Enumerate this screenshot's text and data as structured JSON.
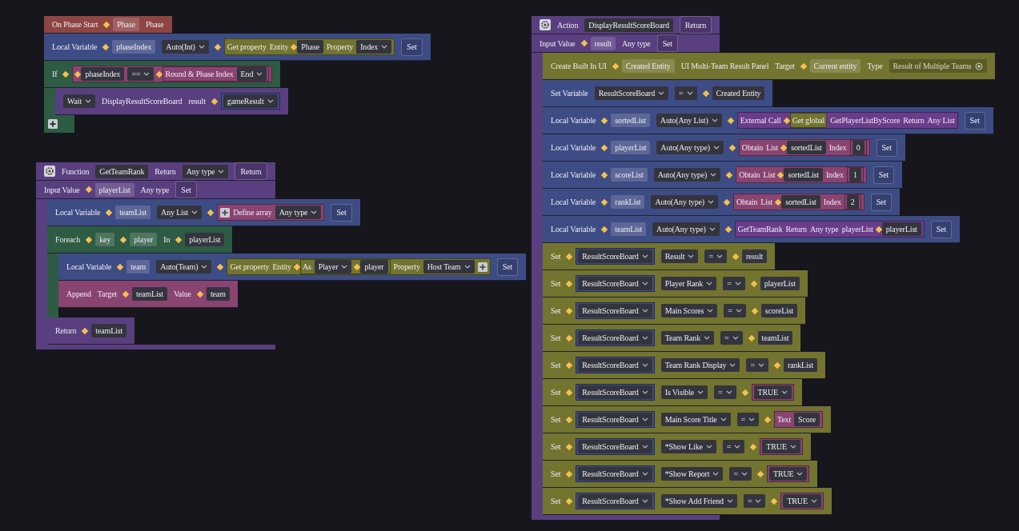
{
  "stacks": [
    {
      "blocks": [
        {
          "color": "#8e4543",
          "lines": [
            {
              "parts": [
                {
                  "kind": "label",
                  "text": "On Phase Start"
                },
                {
                  "kind": "var",
                  "text": "Phase",
                  "pin": true
                },
                {
                  "kind": "label",
                  "text": "Phase"
                }
              ]
            }
          ]
        },
        {
          "color": "#3e4c85",
          "lines": [
            {
              "parts": [
                {
                  "kind": "label",
                  "text": "Local Variable"
                },
                {
                  "kind": "var",
                  "text": "phaseIndex",
                  "pin": true
                },
                {
                  "kind": "dropdown",
                  "text": "Auto(Int)"
                },
                {
                  "kind": "block",
                  "color": "#72742f",
                  "pin": true,
                  "parts": [
                    {
                      "kind": "label",
                      "text": "Get property"
                    },
                    {
                      "kind": "label",
                      "text": "Entity"
                    },
                    {
                      "kind": "field",
                      "text": "Phase",
                      "pin": true
                    },
                    {
                      "kind": "label",
                      "text": "Property"
                    },
                    {
                      "kind": "dropdown",
                      "text": "Index"
                    }
                  ]
                },
                {
                  "kind": "set",
                  "text": "Set"
                }
              ]
            }
          ]
        },
        {
          "color": "#2d5b43",
          "lines": [
            {
              "parts": [
                {
                  "kind": "label",
                  "text": "If"
                },
                {
                  "kind": "block",
                  "color": "#8a4471",
                  "pin": true,
                  "parts": [
                    {
                      "kind": "field",
                      "text": "phaseIndex",
                      "pin": true
                    },
                    {
                      "kind": "dropdown",
                      "text": "=="
                    },
                    {
                      "kind": "block",
                      "color": "#8a4471",
                      "pin": true,
                      "parts": [
                        {
                          "kind": "label",
                          "text": "Round & Phase Index"
                        },
                        {
                          "kind": "dropdown",
                          "text": "End"
                        }
                      ]
                    }
                  ]
                }
              ]
            }
          ],
          "body": [
            {
              "color": "#5a3f80",
              "lines": [
                {
                  "parts": [
                    {
                      "kind": "dropdown",
                      "text": "Wait"
                    },
                    {
                      "kind": "label",
                      "text": "DisplayResultScoreBoard"
                    },
                    {
                      "kind": "label",
                      "text": "result"
                    },
                    {
                      "kind": "block",
                      "color": "#3e4c85",
                      "pin": true,
                      "parts": [
                        {
                          "kind": "dropdown",
                          "text": "gameResult"
                        }
                      ]
                    }
                  ]
                }
              ]
            }
          ],
          "footer": {
            "kind": "plus"
          }
        }
      ]
    },
    {
      "blocks": [
        {
          "color": "#5a3f80",
          "lines": [
            {
              "parts": [
                {
                  "kind": "gear"
                },
                {
                  "kind": "label",
                  "text": "Function"
                },
                {
                  "kind": "field",
                  "text": "GetTeamRank"
                },
                {
                  "kind": "label",
                  "text": "Return"
                },
                {
                  "kind": "dropdown",
                  "text": "Any type"
                },
                {
                  "kind": "set",
                  "text": "Return"
                }
              ]
            },
            {
              "parts": [
                {
                  "kind": "label",
                  "text": "Input Value"
                },
                {
                  "kind": "var",
                  "text": "playerList",
                  "pin": true
                },
                {
                  "kind": "label",
                  "text": "Any type"
                },
                {
                  "kind": "set",
                  "text": "Set"
                }
              ]
            }
          ],
          "body": [
            {
              "color": "#3e4c85",
              "lines": [
                {
                  "parts": [
                    {
                      "kind": "label",
                      "text": "Local Variable"
                    },
                    {
                      "kind": "var",
                      "text": "teamList",
                      "pin": true
                    },
                    {
                      "kind": "dropdown",
                      "text": "Any List"
                    },
                    {
                      "kind": "block",
                      "color": "#8a4471",
                      "pin": true,
                      "parts": [
                        {
                          "kind": "plus"
                        },
                        {
                          "kind": "label",
                          "text": "Define array"
                        },
                        {
                          "kind": "dropdown",
                          "text": "Any type"
                        }
                      ]
                    },
                    {
                      "kind": "set",
                      "text": "Set"
                    }
                  ]
                }
              ]
            },
            {
              "color": "#2d5b43",
              "lines": [
                {
                  "parts": [
                    {
                      "kind": "label",
                      "text": "Foreach"
                    },
                    {
                      "kind": "var",
                      "text": "key",
                      "pin": true
                    },
                    {
                      "kind": "var",
                      "text": "player",
                      "pin": true
                    },
                    {
                      "kind": "label",
                      "text": "In"
                    },
                    {
                      "kind": "field",
                      "text": "playerList",
                      "pin": true
                    }
                  ]
                }
              ],
              "body": [
                {
                  "color": "#3e4c85",
                  "lines": [
                    {
                      "parts": [
                        {
                          "kind": "label",
                          "text": "Local Variable"
                        },
                        {
                          "kind": "var",
                          "text": "team",
                          "pin": true
                        },
                        {
                          "kind": "dropdown",
                          "text": "Auto(Team)"
                        },
                        {
                          "kind": "block",
                          "color": "#72742f",
                          "pin": true,
                          "parts": [
                            {
                              "kind": "label",
                              "text": "Get property"
                            },
                            {
                              "kind": "label",
                              "text": "Entity"
                            },
                            {
                              "kind": "block",
                              "color": "#72742f",
                              "pin": true,
                              "parts": [
                                {
                                  "kind": "label",
                                  "text": "As"
                                },
                                {
                                  "kind": "dropdown",
                                  "text": "Player"
                                },
                                {
                                  "kind": "field",
                                  "text": "player",
                                  "pin": true
                                }
                              ]
                            },
                            {
                              "kind": "label",
                              "text": "Property"
                            },
                            {
                              "kind": "dropdown",
                              "text": "Host Team"
                            },
                            {
                              "kind": "plus"
                            }
                          ]
                        },
                        {
                          "kind": "set",
                          "text": "Set"
                        }
                      ]
                    }
                  ]
                },
                {
                  "color": "#8a4471",
                  "lines": [
                    {
                      "parts": [
                        {
                          "kind": "label",
                          "text": "Append"
                        },
                        {
                          "kind": "label",
                          "text": "Target"
                        },
                        {
                          "kind": "field",
                          "text": "teamList",
                          "pin": true
                        },
                        {
                          "kind": "label",
                          "text": "Value"
                        },
                        {
                          "kind": "field",
                          "text": "team",
                          "pin": true
                        }
                      ]
                    }
                  ]
                }
              ],
              "footer": {
                "kind": "stub"
              }
            },
            {
              "color": "#5a3f80",
              "lines": [
                {
                  "parts": [
                    {
                      "kind": "label",
                      "text": "Return"
                    },
                    {
                      "kind": "field",
                      "text": "teamList",
                      "pin": true
                    }
                  ]
                }
              ]
            }
          ],
          "footer": {
            "kind": "bar"
          }
        }
      ]
    },
    {
      "blocks": [
        {
          "color": "#5a3f80",
          "lines": [
            {
              "parts": [
                {
                  "kind": "gear"
                },
                {
                  "kind": "label",
                  "text": "Action"
                },
                {
                  "kind": "field",
                  "text": "DisplayResultScoreBoard"
                },
                {
                  "kind": "set",
                  "text": "Return"
                }
              ]
            },
            {
              "parts": [
                {
                  "kind": "label",
                  "text": "Input Value"
                },
                {
                  "kind": "var",
                  "text": "result",
                  "pin": true
                },
                {
                  "kind": "label",
                  "text": "Any type"
                },
                {
                  "kind": "set",
                  "text": "Set"
                }
              ]
            }
          ],
          "body": [
            {
              "color": "#72742f",
              "lines": [
                {
                  "parts": [
                    {
                      "kind": "label",
                      "text": "Create Built In UI"
                    },
                    {
                      "kind": "var",
                      "text": "Created Entity",
                      "pin": true
                    },
                    {
                      "kind": "label",
                      "text": "UI Multi-Team Result Panel"
                    },
                    {
                      "kind": "label",
                      "text": "Target"
                    },
                    {
                      "kind": "var",
                      "text": "Current entity",
                      "pin": true
                    },
                    {
                      "kind": "label",
                      "text": "Type"
                    },
                    {
                      "kind": "picker",
                      "text": "Result of Multiple Teams"
                    }
                  ]
                }
              ]
            },
            {
              "color": "#3e4c85",
              "lines": [
                {
                  "parts": [
                    {
                      "kind": "label",
                      "text": "Set Variable"
                    },
                    {
                      "kind": "dropdown",
                      "text": "ResultScoreBoard"
                    },
                    {
                      "kind": "dropdown",
                      "text": "="
                    },
                    {
                      "kind": "field",
                      "text": "Created Entity",
                      "pin": true
                    }
                  ]
                }
              ]
            },
            {
              "color": "#3e4c85",
              "lines": [
                {
                  "parts": [
                    {
                      "kind": "label",
                      "text": "Local Variable"
                    },
                    {
                      "kind": "var",
                      "text": "sortedList",
                      "pin": true
                    },
                    {
                      "kind": "dropdown",
                      "text": "Auto(Any List)"
                    },
                    {
                      "kind": "block",
                      "color": "#6a3c8a",
                      "pin": true,
                      "parts": [
                        {
                          "kind": "label",
                          "text": "External Call"
                        },
                        {
                          "kind": "block",
                          "color": "#72742f",
                          "pin": true,
                          "parts": [
                            {
                              "kind": "label",
                              "text": "Get global"
                            }
                          ]
                        },
                        {
                          "kind": "label",
                          "text": "GetPlayerListByScore"
                        },
                        {
                          "kind": "label",
                          "text": "Return"
                        },
                        {
                          "kind": "label",
                          "text": "Any List"
                        }
                      ]
                    },
                    {
                      "kind": "set",
                      "text": "Set"
                    }
                  ]
                }
              ]
            },
            {
              "color": "#3e4c85",
              "lines": [
                {
                  "parts": [
                    {
                      "kind": "label",
                      "text": "Local Variable"
                    },
                    {
                      "kind": "var",
                      "text": "playerList",
                      "pin": true
                    },
                    {
                      "kind": "dropdown",
                      "text": "Auto(Any type)"
                    },
                    {
                      "kind": "block",
                      "color": "#8a4471",
                      "pin": true,
                      "parts": [
                        {
                          "kind": "label",
                          "text": "Obtain"
                        },
                        {
                          "kind": "label",
                          "text": "List"
                        },
                        {
                          "kind": "field",
                          "text": "sortedList",
                          "pin": true
                        },
                        {
                          "kind": "label",
                          "text": "Index"
                        },
                        {
                          "kind": "block",
                          "color": "#8a4471",
                          "parts": [
                            {
                              "kind": "field",
                              "text": "0"
                            }
                          ]
                        }
                      ]
                    },
                    {
                      "kind": "set",
                      "text": "Set"
                    }
                  ]
                }
              ]
            },
            {
              "color": "#3e4c85",
              "lines": [
                {
                  "parts": [
                    {
                      "kind": "label",
                      "text": "Local Variable"
                    },
                    {
                      "kind": "var",
                      "text": "scoreList",
                      "pin": true
                    },
                    {
                      "kind": "dropdown",
                      "text": "Auto(Any type)"
                    },
                    {
                      "kind": "block",
                      "color": "#8a4471",
                      "pin": true,
                      "parts": [
                        {
                          "kind": "label",
                          "text": "Obtain"
                        },
                        {
                          "kind": "label",
                          "text": "List"
                        },
                        {
                          "kind": "field",
                          "text": "sortedList",
                          "pin": true
                        },
                        {
                          "kind": "label",
                          "text": "Index"
                        },
                        {
                          "kind": "block",
                          "color": "#8a4471",
                          "parts": [
                            {
                              "kind": "field",
                              "text": "1"
                            }
                          ]
                        }
                      ]
                    },
                    {
                      "kind": "set",
                      "text": "Set"
                    }
                  ]
                }
              ]
            },
            {
              "color": "#3e4c85",
              "lines": [
                {
                  "parts": [
                    {
                      "kind": "label",
                      "text": "Local Variable"
                    },
                    {
                      "kind": "var",
                      "text": "rankList",
                      "pin": true
                    },
                    {
                      "kind": "dropdown",
                      "text": "Auto(Any type)"
                    },
                    {
                      "kind": "block",
                      "color": "#8a4471",
                      "pin": true,
                      "parts": [
                        {
                          "kind": "label",
                          "text": "Obtain"
                        },
                        {
                          "kind": "label",
                          "text": "List"
                        },
                        {
                          "kind": "field",
                          "text": "sortedList",
                          "pin": true
                        },
                        {
                          "kind": "label",
                          "text": "Index"
                        },
                        {
                          "kind": "block",
                          "color": "#8a4471",
                          "parts": [
                            {
                              "kind": "field",
                              "text": "2"
                            }
                          ]
                        }
                      ]
                    },
                    {
                      "kind": "set",
                      "text": "Set"
                    }
                  ]
                }
              ]
            },
            {
              "color": "#3e4c85",
              "lines": [
                {
                  "parts": [
                    {
                      "kind": "label",
                      "text": "Local Variable"
                    },
                    {
                      "kind": "var",
                      "text": "teamList",
                      "pin": true
                    },
                    {
                      "kind": "dropdown",
                      "text": "Auto(Any type)"
                    },
                    {
                      "kind": "block",
                      "color": "#6a3c8a",
                      "pin": true,
                      "parts": [
                        {
                          "kind": "label",
                          "text": "GetTeamRank"
                        },
                        {
                          "kind": "label",
                          "text": "Return"
                        },
                        {
                          "kind": "label",
                          "text": "Any type"
                        },
                        {
                          "kind": "label",
                          "text": "playerList"
                        },
                        {
                          "kind": "field",
                          "text": "playerList",
                          "pin": true
                        }
                      ]
                    },
                    {
                      "kind": "set",
                      "text": "Set"
                    }
                  ]
                }
              ]
            },
            {
              "color": "#72742f",
              "lines": [
                {
                  "parts": [
                    {
                      "kind": "label",
                      "text": "Set"
                    },
                    {
                      "kind": "block",
                      "color": "#3e4c85",
                      "pin": true,
                      "parts": [
                        {
                          "kind": "dropdown",
                          "text": "ResultScoreBoard"
                        }
                      ]
                    },
                    {
                      "kind": "dropdown",
                      "text": "Result"
                    },
                    {
                      "kind": "dropdown",
                      "text": "="
                    },
                    {
                      "kind": "field",
                      "text": "result",
                      "pin": true
                    }
                  ]
                }
              ]
            },
            {
              "color": "#72742f",
              "lines": [
                {
                  "parts": [
                    {
                      "kind": "label",
                      "text": "Set"
                    },
                    {
                      "kind": "block",
                      "color": "#3e4c85",
                      "pin": true,
                      "parts": [
                        {
                          "kind": "dropdown",
                          "text": "ResultScoreBoard"
                        }
                      ]
                    },
                    {
                      "kind": "dropdown",
                      "text": "Player Rank"
                    },
                    {
                      "kind": "dropdown",
                      "text": "="
                    },
                    {
                      "kind": "field",
                      "text": "playerList",
                      "pin": true
                    }
                  ]
                }
              ]
            },
            {
              "color": "#72742f",
              "lines": [
                {
                  "parts": [
                    {
                      "kind": "label",
                      "text": "Set"
                    },
                    {
                      "kind": "block",
                      "color": "#3e4c85",
                      "pin": true,
                      "parts": [
                        {
                          "kind": "dropdown",
                          "text": "ResultScoreBoard"
                        }
                      ]
                    },
                    {
                      "kind": "dropdown",
                      "text": "Main Scores"
                    },
                    {
                      "kind": "dropdown",
                      "text": "="
                    },
                    {
                      "kind": "field",
                      "text": "scoreList",
                      "pin": true
                    }
                  ]
                }
              ]
            },
            {
              "color": "#72742f",
              "lines": [
                {
                  "parts": [
                    {
                      "kind": "label",
                      "text": "Set"
                    },
                    {
                      "kind": "block",
                      "color": "#3e4c85",
                      "pin": true,
                      "parts": [
                        {
                          "kind": "dropdown",
                          "text": "ResultScoreBoard"
                        }
                      ]
                    },
                    {
                      "kind": "dropdown",
                      "text": "Team Rank"
                    },
                    {
                      "kind": "dropdown",
                      "text": "="
                    },
                    {
                      "kind": "field",
                      "text": "teamList",
                      "pin": true
                    }
                  ]
                }
              ]
            },
            {
              "color": "#72742f",
              "lines": [
                {
                  "parts": [
                    {
                      "kind": "label",
                      "text": "Set"
                    },
                    {
                      "kind": "block",
                      "color": "#3e4c85",
                      "pin": true,
                      "parts": [
                        {
                          "kind": "dropdown",
                          "text": "ResultScoreBoard"
                        }
                      ]
                    },
                    {
                      "kind": "dropdown",
                      "text": "Team Rank Display"
                    },
                    {
                      "kind": "dropdown",
                      "text": "="
                    },
                    {
                      "kind": "field",
                      "text": "rankList",
                      "pin": true
                    }
                  ]
                }
              ]
            },
            {
              "color": "#72742f",
              "lines": [
                {
                  "parts": [
                    {
                      "kind": "label",
                      "text": "Set"
                    },
                    {
                      "kind": "block",
                      "color": "#3e4c85",
                      "pin": true,
                      "parts": [
                        {
                          "kind": "dropdown",
                          "text": "ResultScoreBoard"
                        }
                      ]
                    },
                    {
                      "kind": "dropdown",
                      "text": "Is Visible"
                    },
                    {
                      "kind": "dropdown",
                      "text": "="
                    },
                    {
                      "kind": "block",
                      "color": "#8a4471",
                      "pin": true,
                      "parts": [
                        {
                          "kind": "dropdown",
                          "text": "TRUE"
                        }
                      ]
                    }
                  ]
                }
              ]
            },
            {
              "color": "#72742f",
              "lines": [
                {
                  "parts": [
                    {
                      "kind": "label",
                      "text": "Set"
                    },
                    {
                      "kind": "block",
                      "color": "#3e4c85",
                      "pin": true,
                      "parts": [
                        {
                          "kind": "dropdown",
                          "text": "ResultScoreBoard"
                        }
                      ]
                    },
                    {
                      "kind": "dropdown",
                      "text": "Main Score Title"
                    },
                    {
                      "kind": "dropdown",
                      "text": "="
                    },
                    {
                      "kind": "block",
                      "color": "#8a4471",
                      "pin": true,
                      "parts": [
                        {
                          "kind": "label",
                          "text": "Text"
                        },
                        {
                          "kind": "field",
                          "text": "Score"
                        }
                      ]
                    }
                  ]
                }
              ]
            },
            {
              "color": "#72742f",
              "lines": [
                {
                  "parts": [
                    {
                      "kind": "label",
                      "text": "Set"
                    },
                    {
                      "kind": "block",
                      "color": "#3e4c85",
                      "pin": true,
                      "parts": [
                        {
                          "kind": "dropdown",
                          "text": "ResultScoreBoard"
                        }
                      ]
                    },
                    {
                      "kind": "dropdown",
                      "text": "*Show Like"
                    },
                    {
                      "kind": "dropdown",
                      "text": "="
                    },
                    {
                      "kind": "block",
                      "color": "#8a4471",
                      "pin": true,
                      "parts": [
                        {
                          "kind": "dropdown",
                          "text": "TRUE"
                        }
                      ]
                    }
                  ]
                }
              ]
            },
            {
              "color": "#72742f",
              "lines": [
                {
                  "parts": [
                    {
                      "kind": "label",
                      "text": "Set"
                    },
                    {
                      "kind": "block",
                      "color": "#3e4c85",
                      "pin": true,
                      "parts": [
                        {
                          "kind": "dropdown",
                          "text": "ResultScoreBoard"
                        }
                      ]
                    },
                    {
                      "kind": "dropdown",
                      "text": "*Show Report"
                    },
                    {
                      "kind": "dropdown",
                      "text": "="
                    },
                    {
                      "kind": "block",
                      "color": "#8a4471",
                      "pin": true,
                      "parts": [
                        {
                          "kind": "dropdown",
                          "text": "TRUE"
                        }
                      ]
                    }
                  ]
                }
              ]
            },
            {
              "color": "#72742f",
              "lines": [
                {
                  "parts": [
                    {
                      "kind": "label",
                      "text": "Set"
                    },
                    {
                      "kind": "block",
                      "color": "#3e4c85",
                      "pin": true,
                      "parts": [
                        {
                          "kind": "dropdown",
                          "text": "ResultScoreBoard"
                        }
                      ]
                    },
                    {
                      "kind": "dropdown",
                      "text": "*Show Add Friend"
                    },
                    {
                      "kind": "dropdown",
                      "text": "="
                    },
                    {
                      "kind": "block",
                      "color": "#8a4471",
                      "pin": true,
                      "parts": [
                        {
                          "kind": "dropdown",
                          "text": "TRUE"
                        }
                      ]
                    }
                  ]
                }
              ]
            }
          ],
          "footer": {
            "kind": "bar"
          }
        }
      ]
    }
  ]
}
